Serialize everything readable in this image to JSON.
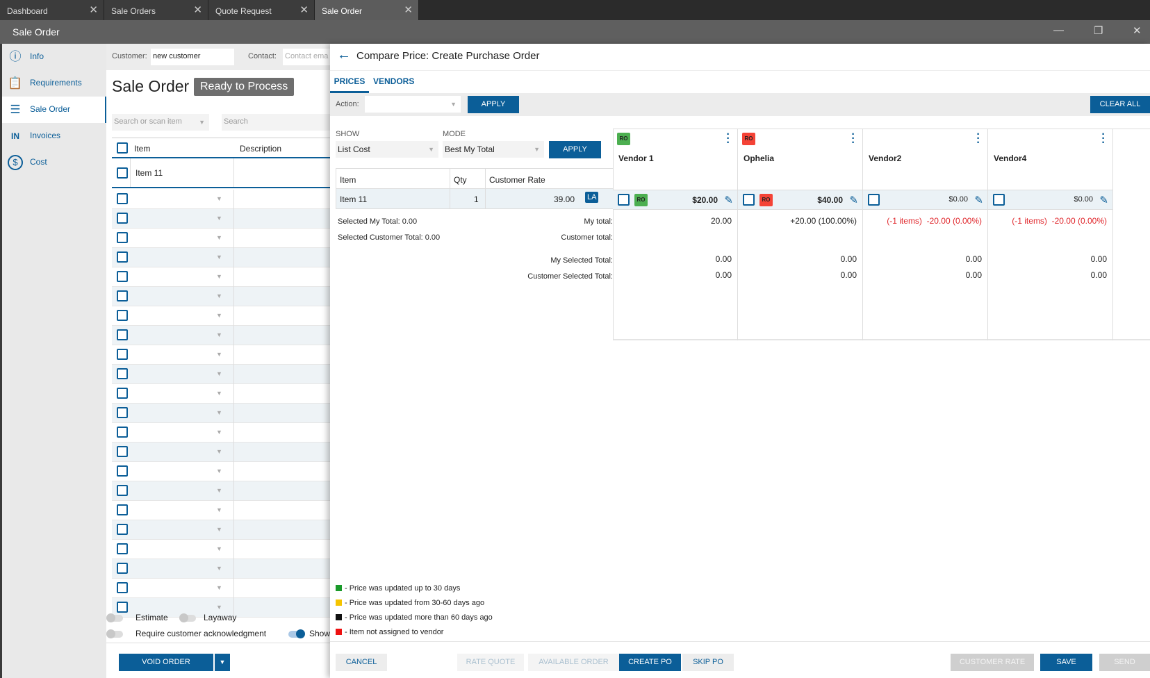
{
  "window_tabs": [
    {
      "label": "Dashboard"
    },
    {
      "label": "Sale Orders"
    },
    {
      "label": "Quote Request"
    },
    {
      "label": "Sale Order"
    }
  ],
  "window": {
    "title": "Sale Order",
    "minimize": "—",
    "restore": "❐",
    "close": "✕"
  },
  "sidebar": {
    "items": [
      {
        "label": "Info",
        "icon": "ⓘ"
      },
      {
        "label": "Requirements",
        "icon": "📋"
      },
      {
        "label": "Sale Order",
        "icon": "☰"
      },
      {
        "label": "Invoices",
        "icon": "IN"
      },
      {
        "label": "Cost",
        "icon": "$"
      }
    ]
  },
  "order": {
    "customer_label": "Customer:",
    "customer_value": "new customer",
    "contact_label": "Contact:",
    "contact_placeholder": "Contact ema",
    "title": "Sale Order",
    "status": "Ready to Process",
    "search_item_placeholder": "Search or scan item",
    "search_placeholder": "Search",
    "col_item": "Item",
    "col_description": "Description",
    "first_item": "Item 11",
    "empty_rows": 22,
    "estimate": "Estimate",
    "layaway": "Layaway",
    "require_ack": "Require customer acknowledgment",
    "show": "Show",
    "void_order": "VOID ORDER"
  },
  "panel": {
    "title": "Compare Price: Create Purchase Order",
    "tabs": [
      "PRICES",
      "VENDORS"
    ],
    "action_label": "Action:",
    "apply": "APPLY",
    "clear_all": "CLEAR ALL",
    "show_label": "SHOW",
    "show_value": "List Cost",
    "mode_label": "MODE",
    "mode_value": "Best My Total",
    "table": {
      "col_item": "Item",
      "col_qty": "Qty",
      "col_rate": "Customer Rate",
      "item": "Item 11",
      "qty": "1",
      "rate": "39.00",
      "rate_badge": "LA"
    },
    "selected_my_total": "Selected My Total: 0.00",
    "selected_customer_total": "Selected Customer Total: 0.00",
    "my_total_label": "My total:",
    "customer_total_label": "Customer total:",
    "my_selected_total_label": "My Selected Total:",
    "customer_selected_total_label": "Customer Selected Total:",
    "vendors": [
      {
        "name": "Vendor 1",
        "badge": "RO",
        "badge_color": "#4caf50",
        "price": "$20.00",
        "bold": true,
        "my_total": "20.00",
        "items_diff": "",
        "red": false,
        "my_sel": "0.00",
        "cust_sel": "0.00"
      },
      {
        "name": "Ophelia",
        "badge": "RO",
        "badge_color": "#f44336",
        "price": "$40.00",
        "bold": true,
        "my_total": "+20.00 (100.00%)",
        "items_diff": "",
        "red": false,
        "my_sel": "0.00",
        "cust_sel": "0.00"
      },
      {
        "name": "Vendor2",
        "badge": "",
        "price": "$0.00",
        "bold": false,
        "my_total": "-20.00 (0.00%)",
        "items_diff": "(-1 items)",
        "red": true,
        "my_sel": "0.00",
        "cust_sel": "0.00"
      },
      {
        "name": "Vendor4",
        "badge": "",
        "price": "$0.00",
        "bold": false,
        "my_total": "-20.00 (0.00%)",
        "items_diff": "(-1 items)",
        "red": true,
        "my_sel": "0.00",
        "cust_sel": "0.00"
      }
    ],
    "legend": [
      {
        "color": "#1a9a2a",
        "text": "- Price was updated up to 30 days"
      },
      {
        "color": "#f5c400",
        "text": "- Price was updated from 30-60 days ago"
      },
      {
        "color": "#111111",
        "text": "- Price was updated more than 60 days ago"
      },
      {
        "color": "#ee1111",
        "text": "- Item not assigned to vendor"
      }
    ],
    "footer": {
      "cancel": "CANCEL",
      "rate_quote": "RATE QUOTE",
      "available_order": "AVAILABLE ORDER",
      "create_po": "CREATE PO",
      "skip_po": "SKIP PO",
      "customer_rate": "CUSTOMER RATE",
      "save": "SAVE",
      "send": "SEND"
    }
  }
}
